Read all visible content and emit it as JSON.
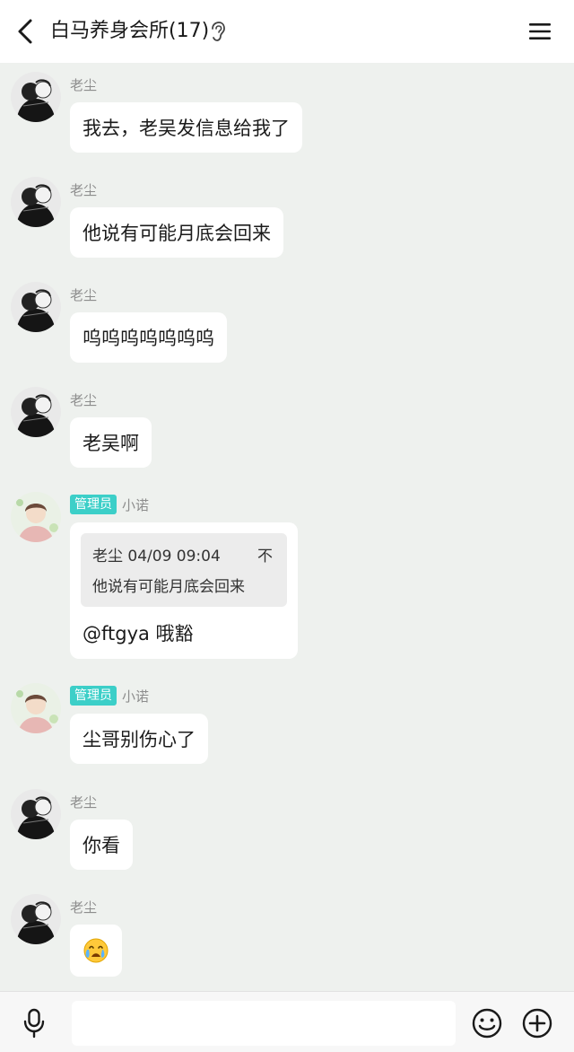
{
  "header": {
    "title": "白马养身会所(17)",
    "back_icon": "chevron-left-icon",
    "ear_icon": "ear-icon",
    "menu_icon": "hamburger-menu-icon"
  },
  "messages": [
    {
      "sender": "老尘",
      "text": "我去，老吴发信息给我了"
    },
    {
      "sender": "老尘",
      "text": "他说有可能月底会回来"
    },
    {
      "sender": "老尘",
      "text": "呜呜呜呜呜呜呜"
    },
    {
      "sender": "老尘",
      "text": "老吴啊"
    },
    {
      "badge": "管理员",
      "sender": "小诺",
      "quote": {
        "meta": "老尘 04/09 09:04",
        "pin": "不",
        "text": "他说有可能月底会回来"
      },
      "text": "@ftgya 哦豁"
    },
    {
      "badge": "管理员",
      "sender": "小诺",
      "text": "尘哥别伤心了"
    },
    {
      "sender": "老尘",
      "text": "你看"
    },
    {
      "sender": "老尘",
      "emoji": "crying-face-icon"
    }
  ],
  "input": {
    "placeholder": "",
    "mic_icon": "microphone-icon",
    "emoji_icon": "smiley-icon",
    "plus_icon": "plus-circle-icon"
  },
  "colors": {
    "background": "#eef1ee",
    "bubble": "#ffffff",
    "admin_badge": "#3ccfc8"
  }
}
